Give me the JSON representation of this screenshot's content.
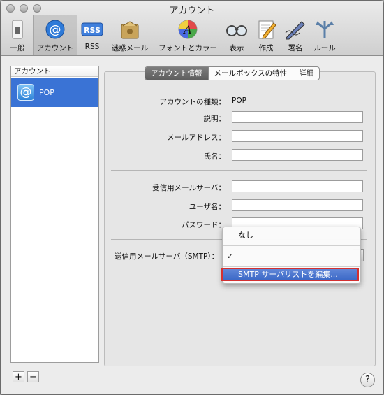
{
  "window": {
    "title": "アカウント"
  },
  "toolbar": {
    "items": [
      {
        "label": "一般",
        "icon": "switch-icon"
      },
      {
        "label": "アカウント",
        "icon": "at-icon"
      },
      {
        "label": "RSS",
        "icon": "rss-icon"
      },
      {
        "label": "迷惑メール",
        "icon": "junk-mail-icon"
      },
      {
        "label": "フォントとカラー",
        "icon": "font-color-icon"
      },
      {
        "label": "表示",
        "icon": "glasses-icon"
      },
      {
        "label": "作成",
        "icon": "pencil-paper-icon"
      },
      {
        "label": "署名",
        "icon": "signature-pen-icon"
      },
      {
        "label": "ルール",
        "icon": "rules-icon"
      }
    ],
    "rss_badge": "RSS",
    "font_glyph": "A"
  },
  "sidebar": {
    "header": "アカウント",
    "accounts": [
      {
        "name": "POP",
        "icon": "at-icon"
      }
    ],
    "add_label": "+",
    "remove_label": "−"
  },
  "tabs": [
    {
      "label": "アカウント情報",
      "active": true
    },
    {
      "label": "メールボックスの特性",
      "active": false
    },
    {
      "label": "詳細",
      "active": false
    }
  ],
  "form": {
    "account_type_label": "アカウントの種類：",
    "account_type_value": "POP",
    "description_label": "説明：",
    "email_label": "メールアドレス：",
    "fullname_label": "氏名：",
    "incoming_server_label": "受信用メールサーバ：",
    "username_label": "ユーザ名：",
    "password_label": "パスワード：",
    "smtp_label": "送信用メールサーバ（SMTP）："
  },
  "smtp_menu": {
    "options": [
      "なし",
      "✓"
    ],
    "highlighted": "SMTP サーバリストを編集..."
  },
  "help_label": "?",
  "colors": {
    "selection": "#3a73d5",
    "highlight_border": "#d43030"
  }
}
